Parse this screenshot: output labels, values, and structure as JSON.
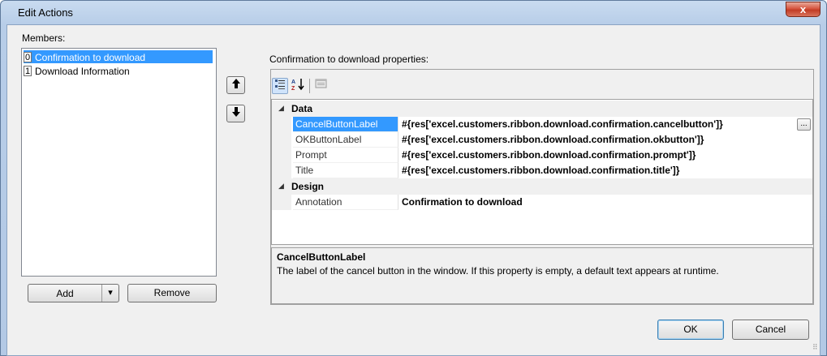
{
  "window": {
    "title": "Edit Actions",
    "close_glyph": "x"
  },
  "members": {
    "label": "Members:",
    "items": [
      {
        "index": "0",
        "label": "Confirmation to download",
        "selected": true
      },
      {
        "index": "1",
        "label": "Download Information",
        "selected": false
      }
    ],
    "add_label": "Add",
    "add_dropdown_glyph": "▾",
    "remove_label": "Remove",
    "move_up_glyph": "🡅",
    "move_down_glyph": "🡇"
  },
  "properties": {
    "header": "Confirmation to download properties:",
    "toolbar": {
      "categorized_icon": "categorized-icon",
      "alphabetical_icon": "alphabetical-icon",
      "property_pages_icon": "property-pages-icon"
    },
    "categories": [
      {
        "name": "Data",
        "expander": "◢",
        "rows": [
          {
            "name": "CancelButtonLabel",
            "value": "#{res['excel.customers.ribbon.download.confirmation.cancelbutton']}",
            "selected": true
          },
          {
            "name": "OKButtonLabel",
            "value": "#{res['excel.customers.ribbon.download.confirmation.okbutton']}",
            "selected": false
          },
          {
            "name": "Prompt",
            "value": "#{res['excel.customers.ribbon.download.confirmation.prompt']}",
            "selected": false
          },
          {
            "name": "Title",
            "value": "#{res['excel.customers.ribbon.download.confirmation.title']}",
            "selected": false
          }
        ]
      },
      {
        "name": "Design",
        "expander": "◢",
        "rows": [
          {
            "name": "Annotation",
            "value": "Confirmation to download",
            "selected": false
          }
        ]
      }
    ],
    "ellipsis_label": "...",
    "description": {
      "title": "CancelButtonLabel",
      "text": "The label of the cancel button in the window. If this property is empty, a default text appears at runtime."
    }
  },
  "footer": {
    "ok_label": "OK",
    "cancel_label": "Cancel"
  }
}
